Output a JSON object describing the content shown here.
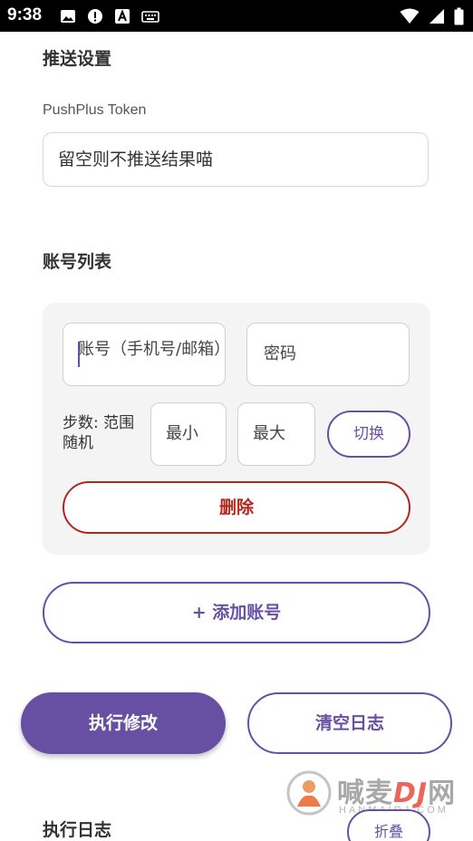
{
  "status_bar": {
    "time": "9:38"
  },
  "push_settings": {
    "title": "推送设置",
    "token_label": "PushPlus Token",
    "token_placeholder": "留空则不推送结果喵"
  },
  "accounts": {
    "title": "账号列表",
    "items": [
      {
        "username_placeholder": "账号（手机号/邮箱）",
        "password_placeholder": "密码",
        "steps_label": "步数: 范围随机",
        "min_placeholder": "最小",
        "max_placeholder": "最大",
        "toggle_label": "切换",
        "delete_label": "删除"
      }
    ],
    "add_label": "+ 添加账号"
  },
  "actions": {
    "execute_label": "执行修改",
    "clear_label": "清空日志"
  },
  "log": {
    "title": "执行日志",
    "fold_label": "折叠"
  },
  "watermark": {
    "brand": "喊麦",
    "dj": "DJ",
    "suffix": "网",
    "sub": "HANMAIDJ.COM"
  },
  "colors": {
    "accent": "#6750a4",
    "danger": "#b3261e",
    "card_bg": "#f4f4f4"
  }
}
